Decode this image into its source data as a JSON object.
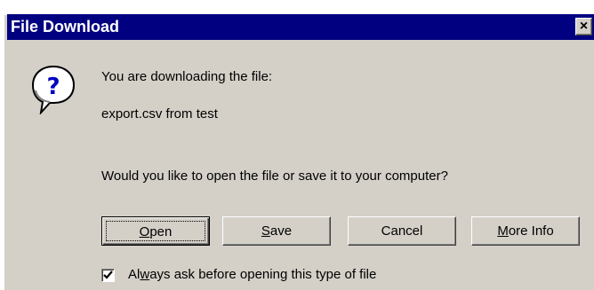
{
  "window": {
    "title": "File Download",
    "close_glyph": "×"
  },
  "icon": "question-icon",
  "message": {
    "line1": "You are downloading the file:",
    "line2": "export.csv from test",
    "question": "Would you like to open the file or save it to your computer?"
  },
  "buttons": {
    "open": {
      "pre": "",
      "accel": "O",
      "post": "pen"
    },
    "save": {
      "pre": "",
      "accel": "S",
      "post": "ave"
    },
    "cancel": {
      "label": "Cancel"
    },
    "more_info": {
      "pre": "",
      "accel": "M",
      "post": "ore Info"
    }
  },
  "checkbox": {
    "checked": true,
    "pre": "Al",
    "accel": "w",
    "post": "ays ask before opening this type of file"
  },
  "colors": {
    "titlebar": "#000080",
    "face": "#d4d0c8"
  }
}
